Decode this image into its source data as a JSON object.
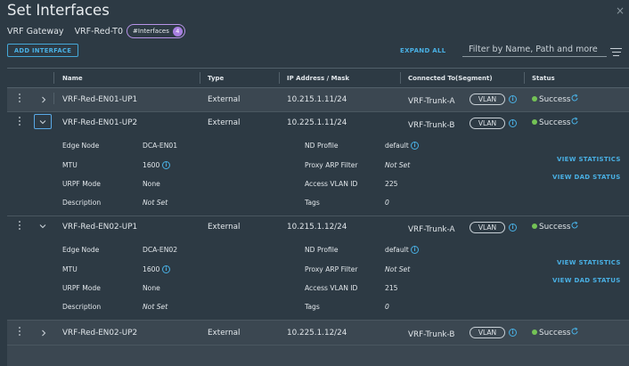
{
  "header": {
    "title": "Set Interfaces",
    "context_label": "VRF Gateway",
    "context_value": "VRF-Red-T0",
    "chip_label": "#Interfaces",
    "chip_count": "4",
    "close_glyph": "×"
  },
  "toolbar": {
    "add_label": "ADD INTERFACE",
    "expand_label": "EXPAND ALL",
    "filter_placeholder": "Filter by Name, Path and more"
  },
  "columns": {
    "name": "Name",
    "type": "Type",
    "ip": "IP Address / Mask",
    "connected": "Connected To(Segment)",
    "status": "Status"
  },
  "labels": {
    "vlan": "VLAN",
    "edge_node": "Edge Node",
    "mtu": "MTU",
    "urpf": "URPF Mode",
    "description": "Description",
    "nd_profile": "ND Profile",
    "proxy_arp": "Proxy ARP Filter",
    "access_vlan": "Access VLAN ID",
    "tags": "Tags",
    "view_statistics": "VIEW STATISTICS",
    "view_dad": "VIEW DAD STATUS"
  },
  "rows": [
    {
      "name": "VRF-Red-EN01-UP1",
      "type": "External",
      "ip": "10.215.1.11/24",
      "segment": "VRF-Trunk-A",
      "status": "Success"
    },
    {
      "name": "VRF-Red-EN01-UP2",
      "type": "External",
      "ip": "10.225.1.11/24",
      "segment": "VRF-Trunk-B",
      "status": "Success",
      "details": {
        "edge_node": "DCA-EN01",
        "mtu": "1600",
        "urpf": "None",
        "description": "Not Set",
        "nd_profile": "default",
        "proxy_arp": "Not Set",
        "access_vlan": "225",
        "tags": "0"
      }
    },
    {
      "name": "VRF-Red-EN02-UP1",
      "type": "External",
      "ip": "10.215.1.12/24",
      "segment": "VRF-Trunk-A",
      "status": "Success",
      "details": {
        "edge_node": "DCA-EN02",
        "mtu": "1600",
        "urpf": "None",
        "description": "Not Set",
        "nd_profile": "default",
        "proxy_arp": "Not Set",
        "access_vlan": "215",
        "tags": "0"
      }
    },
    {
      "name": "VRF-Red-EN02-UP2",
      "type": "External",
      "ip": "10.225.1.12/24",
      "segment": "VRF-Trunk-B",
      "status": "Success"
    }
  ],
  "colors": {
    "accent": "#49b0e4",
    "chip": "#a77fe0",
    "success": "#74c356"
  }
}
